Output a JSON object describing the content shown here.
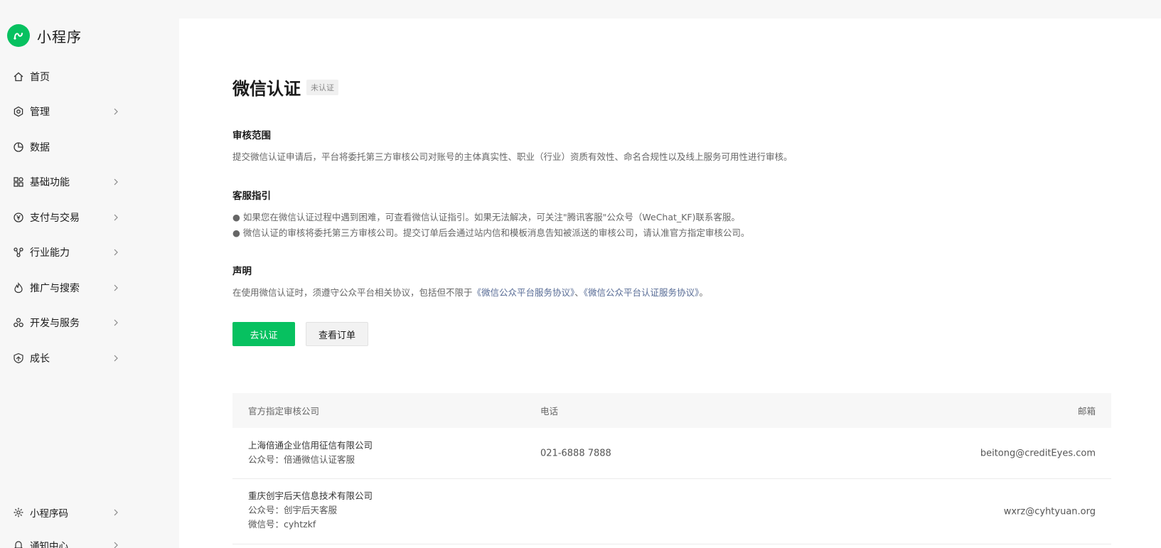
{
  "brand": {
    "title": "小程序",
    "accent": "#07c160"
  },
  "sidebar": {
    "items": [
      {
        "label": "首页",
        "icon": "home-icon",
        "has_chevron": false
      },
      {
        "label": "管理",
        "icon": "hexagon-settings-icon",
        "has_chevron": true
      },
      {
        "label": "数据",
        "icon": "pie-chart-icon",
        "has_chevron": false
      },
      {
        "label": "基础功能",
        "icon": "grid-apps-icon",
        "has_chevron": true
      },
      {
        "label": "支付与交易",
        "icon": "yuan-coin-icon",
        "has_chevron": true
      },
      {
        "label": "行业能力",
        "icon": "nodes-icon",
        "has_chevron": true
      },
      {
        "label": "推广与搜索",
        "icon": "flame-icon",
        "has_chevron": true
      },
      {
        "label": "开发与服务",
        "icon": "cluster-circles-icon",
        "has_chevron": true
      },
      {
        "label": "成长",
        "icon": "shield-growth-icon",
        "has_chevron": true
      }
    ],
    "bottom_items": [
      {
        "label": "小程序码",
        "icon": "sun-code-icon",
        "has_chevron": true
      },
      {
        "label": "通知中心",
        "icon": "bell-icon",
        "has_chevron": true
      }
    ]
  },
  "page": {
    "title": "微信认证",
    "badge": "未认证"
  },
  "review_scope": {
    "heading": "审核范围",
    "text": "提交微信认证申请后，平台将委托第三方审核公司对账号的主体真实性、职业（行业）资质有效性、命名合规性以及线上服务可用性进行审核。"
  },
  "service_guide": {
    "heading": "客服指引",
    "bullet_1": "● 如果您在微信认证过程中遇到困难，可查看微信认证指引。如果无法解决，可关注\"腾讯客服\"公众号（WeChat_KF)联系客服。",
    "bullet_2": "● 微信认证的审核将委托第三方审核公司。提交订单后会通过站内信和模板消息告知被派送的审核公司，请认准官方指定审核公司。"
  },
  "statement": {
    "heading": "声明",
    "prefix": "在使用微信认证时，须遵守公众平台相关协议，包括但不限于",
    "link_1": "《微信公众平台服务协议》",
    "separator": "、",
    "link_2": "《微信公众平台认证服务协议》",
    "suffix": "。"
  },
  "actions": {
    "primary_label": "去认证",
    "secondary_label": "查看订单"
  },
  "table": {
    "headers": {
      "company": "官方指定审核公司",
      "phone": "电话",
      "email": "邮箱"
    },
    "rows": [
      {
        "company": "上海倍通企业信用征信有限公司",
        "line_2": "公众号：倍通微信认证客服",
        "line_3": "",
        "phone": "021-6888 7888",
        "email": "beitong@creditEyes.com"
      },
      {
        "company": "重庆创宇后天信息技术有限公司",
        "line_2": "公众号：创宇后天客服",
        "line_3": "微信号：cyhtzkf",
        "phone": "",
        "email": "wxrz@cyhtyuan.org"
      }
    ]
  }
}
